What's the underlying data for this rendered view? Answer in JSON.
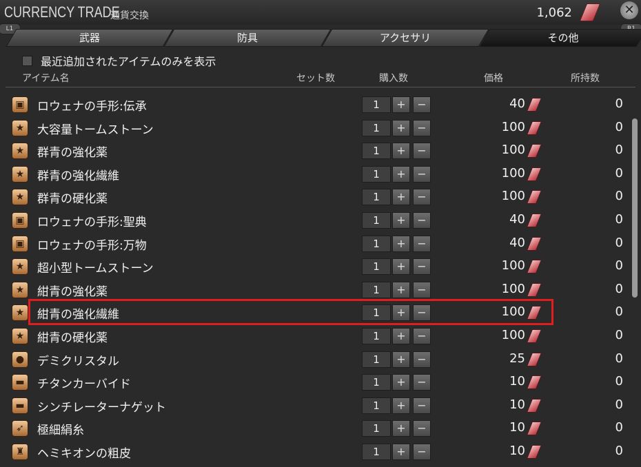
{
  "window": {
    "title": "CURRENCY TRADE",
    "subtitle": "通貨交換",
    "currency_amount": "1,062",
    "currency_icon": "tomestone-icon",
    "close_icon": "close-icon"
  },
  "tabs": [
    {
      "label": "武器",
      "active": false
    },
    {
      "label": "防具",
      "active": false
    },
    {
      "label": "アクセサリ",
      "active": false
    },
    {
      "label": "その他",
      "active": true
    }
  ],
  "shoulders": {
    "left": "L1",
    "right": "R1"
  },
  "filter": {
    "label": "最近追加されたアイテムのみを表示",
    "checked": false
  },
  "columns": {
    "item_name": "アイテム名",
    "set_count": "セット数",
    "purchase_count": "購入数",
    "price": "価格",
    "owned": "所持数"
  },
  "items": [
    {
      "name": "ロウェナの手形:伝承",
      "qty": "1",
      "price": "40",
      "owned": "0",
      "icon": "chest-icon"
    },
    {
      "name": "大容量トームストーン",
      "qty": "1",
      "price": "100",
      "owned": "0",
      "icon": "star-icon"
    },
    {
      "name": "群青の強化薬",
      "qty": "1",
      "price": "100",
      "owned": "0",
      "icon": "star-icon"
    },
    {
      "name": "群青の強化繊維",
      "qty": "1",
      "price": "100",
      "owned": "0",
      "icon": "star-icon"
    },
    {
      "name": "群青の硬化薬",
      "qty": "1",
      "price": "100",
      "owned": "0",
      "icon": "star-icon"
    },
    {
      "name": "ロウェナの手形:聖典",
      "qty": "1",
      "price": "40",
      "owned": "0",
      "icon": "chest-icon"
    },
    {
      "name": "ロウェナの手形:万物",
      "qty": "1",
      "price": "40",
      "owned": "0",
      "icon": "chest-icon"
    },
    {
      "name": "超小型トームストーン",
      "qty": "1",
      "price": "100",
      "owned": "0",
      "icon": "star-icon"
    },
    {
      "name": "紺青の強化薬",
      "qty": "1",
      "price": "100",
      "owned": "0",
      "icon": "star-icon"
    },
    {
      "name": "紺青の強化繊維",
      "qty": "1",
      "price": "100",
      "owned": "0",
      "icon": "star-icon"
    },
    {
      "name": "紺青の硬化薬",
      "qty": "1",
      "price": "100",
      "owned": "0",
      "icon": "star-icon"
    },
    {
      "name": "デミクリスタル",
      "qty": "1",
      "price": "25",
      "owned": "0",
      "icon": "crystal-icon"
    },
    {
      "name": "チタンカーバイド",
      "qty": "1",
      "price": "10",
      "owned": "0",
      "icon": "anvil-icon"
    },
    {
      "name": "シンチレーターナゲット",
      "qty": "1",
      "price": "10",
      "owned": "0",
      "icon": "anvil-icon"
    },
    {
      "name": "極細絹糸",
      "qty": "1",
      "price": "10",
      "owned": "0",
      "icon": "thread-icon"
    },
    {
      "name": "ヘミキオンの粗皮",
      "qty": "1",
      "price": "10",
      "owned": "0",
      "icon": "leather-icon"
    }
  ],
  "buttons": {
    "plus": "+",
    "minus": "−"
  }
}
